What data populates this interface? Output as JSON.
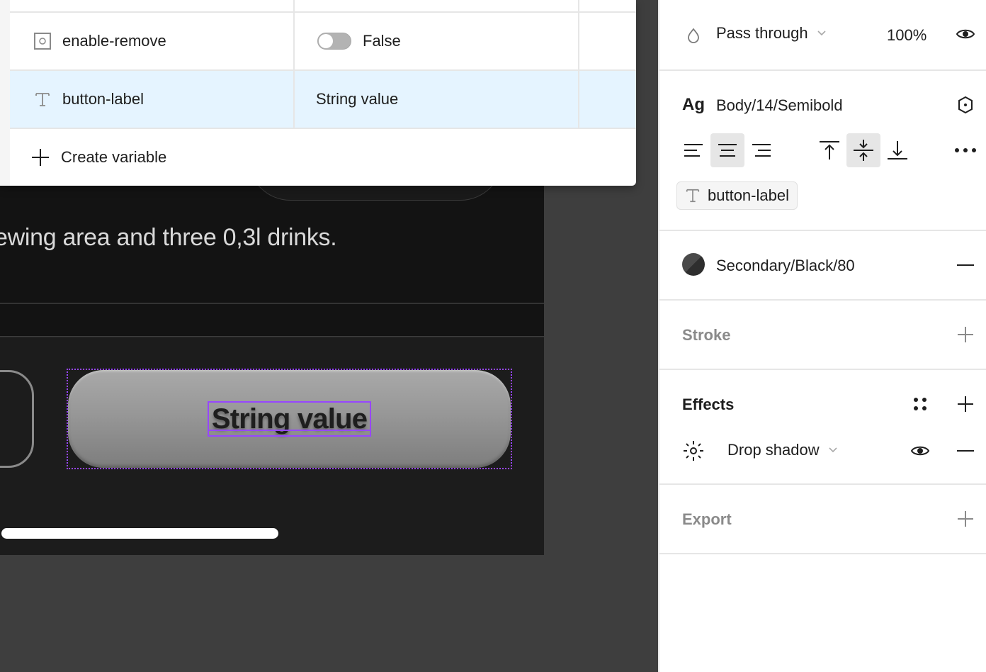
{
  "canvas": {
    "frame_body_text": "ewing area and three 0,3l drinks.",
    "button_label": "String value"
  },
  "variables_popover": {
    "rows": [
      {
        "icon": "boolean-icon",
        "name": "enable-remove",
        "value": "False",
        "toggle_on": false,
        "selected": false
      },
      {
        "icon": "text-icon",
        "name": "button-label",
        "value": "String value",
        "selected": true
      }
    ],
    "create_label": "Create variable"
  },
  "panel": {
    "layer": {
      "blend_mode": "Pass through",
      "opacity": "100%"
    },
    "text": {
      "style_prefix": "Ag",
      "style_name": "Body/14/Semibold",
      "horizontal_align": "center",
      "vertical_align": "middle",
      "bound_variable": "button-label"
    },
    "fill": {
      "style_name": "Secondary/Black/80",
      "swatch_color": "#3c3c3c"
    },
    "stroke": {
      "title": "Stroke"
    },
    "effects": {
      "title": "Effects",
      "items": [
        {
          "type": "Drop shadow",
          "visible": true
        }
      ]
    },
    "export": {
      "title": "Export"
    }
  },
  "colors": {
    "selection": "#9747ff",
    "selected_row_bg": "#e5f4ff",
    "canvas_bg": "#3e3e3e"
  }
}
